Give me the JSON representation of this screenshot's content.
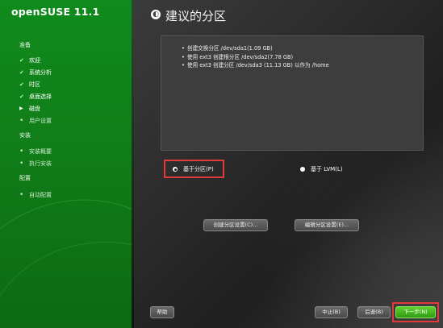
{
  "app": {
    "title": "openSUSE 11.1"
  },
  "sidebar": {
    "sections": [
      {
        "title": "准备",
        "items": [
          {
            "label": "欢迎",
            "state": "done"
          },
          {
            "label": "系统分析",
            "state": "done"
          },
          {
            "label": "时区",
            "state": "done"
          },
          {
            "label": "桌面选择",
            "state": "done"
          },
          {
            "label": "磁盘",
            "state": "current"
          },
          {
            "label": "用户设置",
            "state": "pending"
          }
        ]
      },
      {
        "title": "安装",
        "items": [
          {
            "label": "安装概要",
            "state": "pending"
          },
          {
            "label": "执行安装",
            "state": "pending"
          }
        ]
      },
      {
        "title": "配置",
        "items": [
          {
            "label": "自动配置",
            "state": "pending"
          }
        ]
      }
    ]
  },
  "page": {
    "title": "建议的分区",
    "summary": [
      "创建交换分区 /dev/sda1(1.09 GB)",
      "使用 ext3 创建根分区 /dev/sda2(7.78 GB)",
      "使用 ext3 创建分区 /dev/sda3 (11.13 GB) 以作为 /home"
    ],
    "options": {
      "partition_based": {
        "label": "基于分区(P)",
        "selected": true
      },
      "lvm_based": {
        "label": "基于 LVM(L)",
        "selected": false
      }
    },
    "buttons": {
      "create_setup": "创建分区设置(C)...",
      "edit_setup": "编辑分区设置(E)..."
    }
  },
  "footer": {
    "help": "帮助",
    "abort": "中止(B)",
    "back": "后退(B)",
    "next": "下一步(N)"
  },
  "colors": {
    "sidebar": "#0f8a1c",
    "primary_button": "#3fae1c",
    "highlight": "#e23a3a"
  }
}
